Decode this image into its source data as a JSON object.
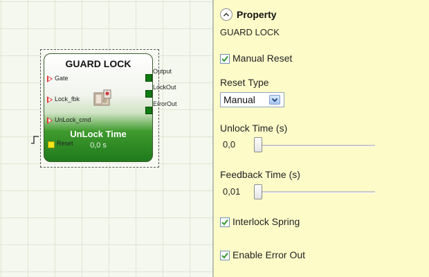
{
  "block": {
    "title": "GUARD LOCK",
    "inputs": [
      "Gate",
      "Lock_fbk",
      "UnLock_cmd",
      "Reset"
    ],
    "outputs": [
      "Output",
      "LockOut",
      "ErrorOut"
    ],
    "caption": "UnLock Time",
    "value": "0,0 s"
  },
  "panel": {
    "heading": "Property",
    "subheading": "GUARD LOCK",
    "manual_reset": {
      "label": "Manual Reset",
      "checked": true
    },
    "reset_type": {
      "label": "Reset Type",
      "value": "Manual"
    },
    "unlock_time": {
      "label": "Unlock Time (s)",
      "value": "0,0"
    },
    "feedback_time": {
      "label": "Feedback Time (s)",
      "value": "0,01"
    },
    "interlock_spring": {
      "label": "Interlock Spring",
      "checked": true
    },
    "enable_error_out": {
      "label": "Enable Error Out",
      "checked": true
    }
  },
  "icons": {
    "collapse": "chevron-up-circle-icon",
    "select_arrow": "chevron-down-icon",
    "device": "guard-lock-device-icon",
    "pulse": "pulse-signal-icon",
    "check": "checkmark-icon"
  },
  "colors": {
    "panel_bg": "#fdfcc9",
    "block_green": "#1f7a1c",
    "input_arrow": "#e23a3a",
    "output_pin": "#127a12",
    "reset_pin": "#f2e81a",
    "check": "#2f9a2f"
  }
}
